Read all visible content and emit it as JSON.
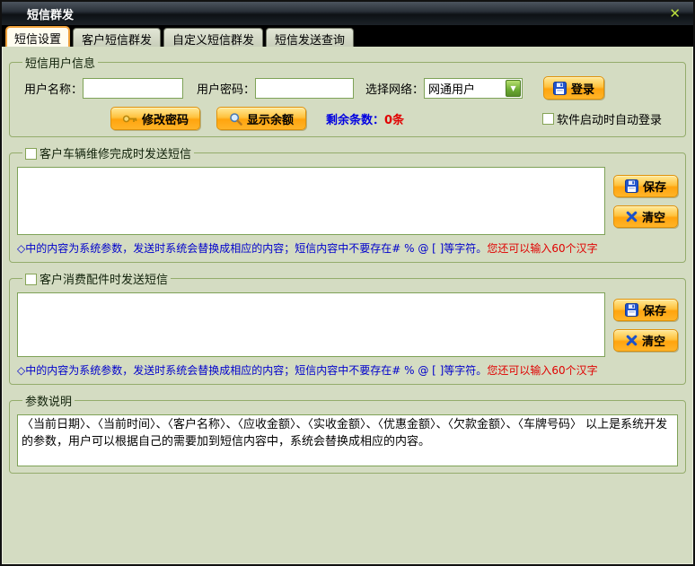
{
  "window": {
    "title": "短信群发"
  },
  "icons": {
    "close": "✕",
    "dropdown_arrow": "▼",
    "save": "floppy-disk",
    "login": "floppy-disk",
    "change_password": "key",
    "show_balance": "magnifier",
    "clear": "blue-x"
  },
  "tabs": [
    {
      "label": "短信设置",
      "active": true
    },
    {
      "label": "客户短信群发",
      "active": false
    },
    {
      "label": "自定义短信群发",
      "active": false
    },
    {
      "label": "短信发送查询",
      "active": false
    }
  ],
  "user_info": {
    "group_title": "短信用户信息",
    "username_label": "用户名称：",
    "username_value": "",
    "password_label": "用户密码：",
    "password_value": "",
    "network_label": "选择网络：",
    "network_selected": "网通用户",
    "login_button": "登录",
    "change_password_button": "修改密码",
    "show_balance_button": "显示余额",
    "remaining_label": "剩余条数：",
    "remaining_value": "0条",
    "auto_login_label": "软件启动时自动登录",
    "auto_login_checked": false
  },
  "repair_sms": {
    "group_title": "客户车辆维修完成时发送短信",
    "checked": false,
    "content": "",
    "save_button": "保存",
    "clear_button": "清空",
    "note": "◇中的内容为系统参数，发送时系统会替换成相应的内容；短信内容中不要存在# % @ [ ]等字符。",
    "note_highlight": "您还可以输入60个汉字"
  },
  "parts_sms": {
    "group_title": "客户消费配件时发送短信",
    "checked": false,
    "content": "",
    "save_button": "保存",
    "clear_button": "清空",
    "note": "◇中的内容为系统参数，发送时系统会替换成相应的内容；短信内容中不要存在# % @ [ ]等字符。",
    "note_highlight": "您还可以输入60个汉字"
  },
  "parameters": {
    "group_title": "参数说明",
    "description": "〈当前日期〉、〈当前时间〉、〈客户名称〉、〈应收金额〉、〈实收金额〉、〈优惠金额〉、〈欠款金额〉、〈车牌号码〉 以上是系统开发的参数，用户可以根据自己的需要加到短信内容中，系统会替换成相应的内容。"
  },
  "colors": {
    "accent_orange": "#FFA40E",
    "note_blue": "#0000CC",
    "alert_red": "#E00000",
    "background": "#D4DCC2",
    "group_border": "#94AC6C",
    "close_green": "#B8DC3C"
  }
}
